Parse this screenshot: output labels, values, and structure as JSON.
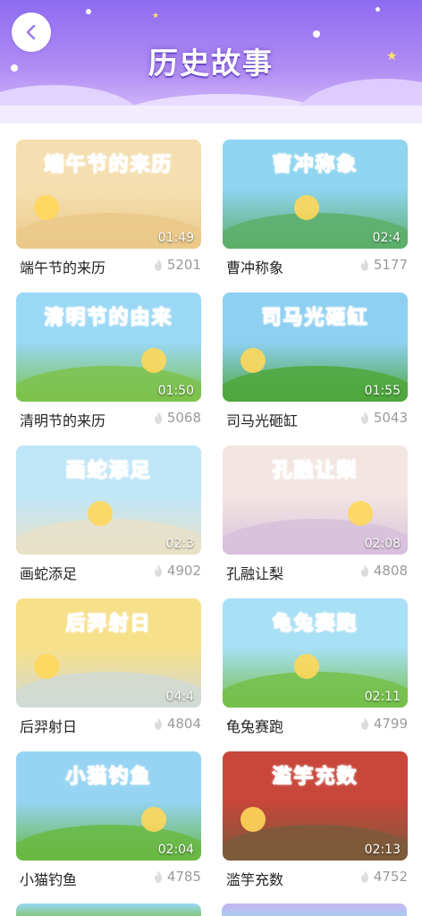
{
  "header": {
    "title": "历史故事",
    "back_icon": "chevron-left-icon",
    "gradient": [
      "#8d6bf0",
      "#d9c4fb"
    ]
  },
  "stories": [
    {
      "thumb_title": "端午节的来历",
      "name": "端午节的来历",
      "duration": "01:49",
      "views": "5201",
      "bg": [
        "#f5dfb0",
        "#eac98a"
      ],
      "title_color": "#e64b8c"
    },
    {
      "thumb_title": "曹冲称象",
      "name": "曹冲称象",
      "duration": "02:4",
      "views": "5177",
      "bg": [
        "#8fd4f0",
        "#5dae6a"
      ],
      "title_color": "#e84a7e"
    },
    {
      "thumb_title": "清明节的由来",
      "name": "清明节的来历",
      "duration": "01:50",
      "views": "5068",
      "bg": [
        "#9ad8f6",
        "#7cc24c"
      ],
      "title_color": "#f06aa2"
    },
    {
      "thumb_title": "司马光砸缸",
      "name": "司马光砸缸",
      "duration": "01:55",
      "views": "5043",
      "bg": [
        "#8ed0f2",
        "#4fa73c"
      ],
      "title_color": "#f2a02a"
    },
    {
      "thumb_title": "画蛇添足",
      "name": "画蛇添足",
      "duration": "02:3",
      "views": "4902",
      "bg": [
        "#bfe6f7",
        "#e8e1c8"
      ],
      "title_color": "#5ab84a"
    },
    {
      "thumb_title": "孔融让梨",
      "name": "孔融让梨",
      "duration": "02:08",
      "views": "4808",
      "bg": [
        "#f3e6e2",
        "#d7c1dc"
      ],
      "title_color": "#7cc03a"
    },
    {
      "thumb_title": "后羿射日",
      "name": "后羿射日",
      "duration": "04:4",
      "views": "4804",
      "bg": [
        "#f7e08a",
        "#d1d9d4"
      ],
      "title_color": "#3ea7e6"
    },
    {
      "thumb_title": "龟兔赛跑",
      "name": "龟兔赛跑",
      "duration": "02:11",
      "views": "4799",
      "bg": [
        "#a8e0f5",
        "#74c04a"
      ],
      "title_color": "#2eb58e"
    },
    {
      "thumb_title": "小猫钓鱼",
      "name": "小猫钓鱼",
      "duration": "02:04",
      "views": "4785",
      "bg": [
        "#97d4f4",
        "#68b842"
      ],
      "title_color": "#3cae3c"
    },
    {
      "thumb_title": "滥竽充数",
      "name": "滥竽充数",
      "duration": "02:13",
      "views": "4752",
      "bg": [
        "#c8463a",
        "#7b5a3b"
      ],
      "title_color": "#3fb4d8"
    }
  ]
}
